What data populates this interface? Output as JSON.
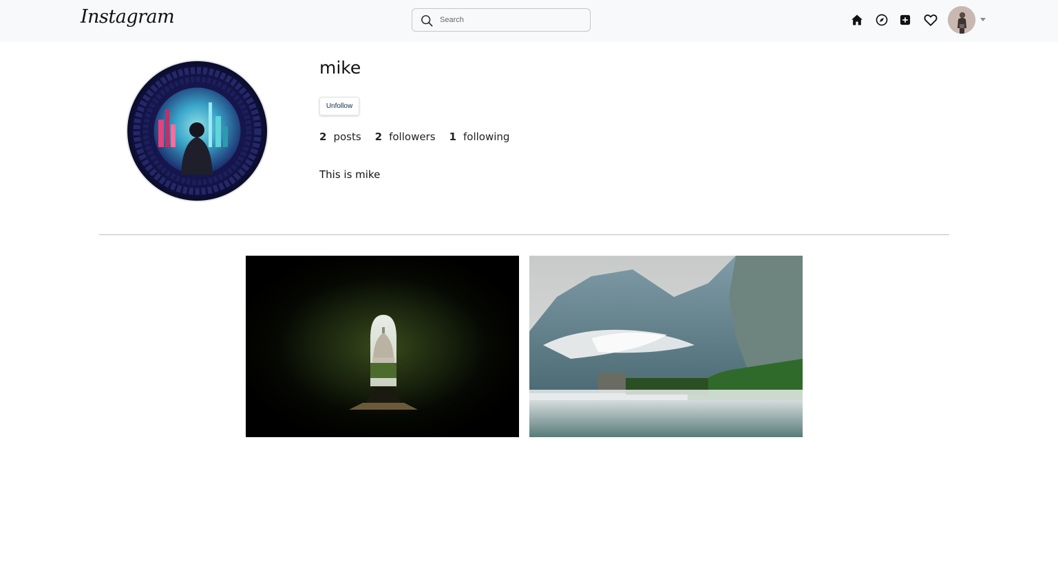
{
  "app": {
    "logo_text": "Instagram"
  },
  "search": {
    "placeholder": "Search",
    "value": ""
  },
  "nav": {
    "icons": [
      "home-icon",
      "explore-icon",
      "new-post-icon",
      "activity-heart-icon",
      "account-avatar",
      "dropdown-caret-icon"
    ]
  },
  "profile": {
    "username": "mike",
    "action_button": "Unfollow",
    "stats": [
      {
        "count": "2",
        "label": "posts"
      },
      {
        "count": "2",
        "label": "followers"
      },
      {
        "count": "1",
        "label": "following"
      }
    ],
    "bio": "This is mike"
  },
  "posts": [
    {
      "subject": "keyhole-view-of-dome"
    },
    {
      "subject": "mountain-lake-with-mist"
    }
  ],
  "colors": {
    "topbar_bg": "#f8f9fa",
    "divider": "#bdbdbd",
    "button_text": "#0f2940"
  }
}
